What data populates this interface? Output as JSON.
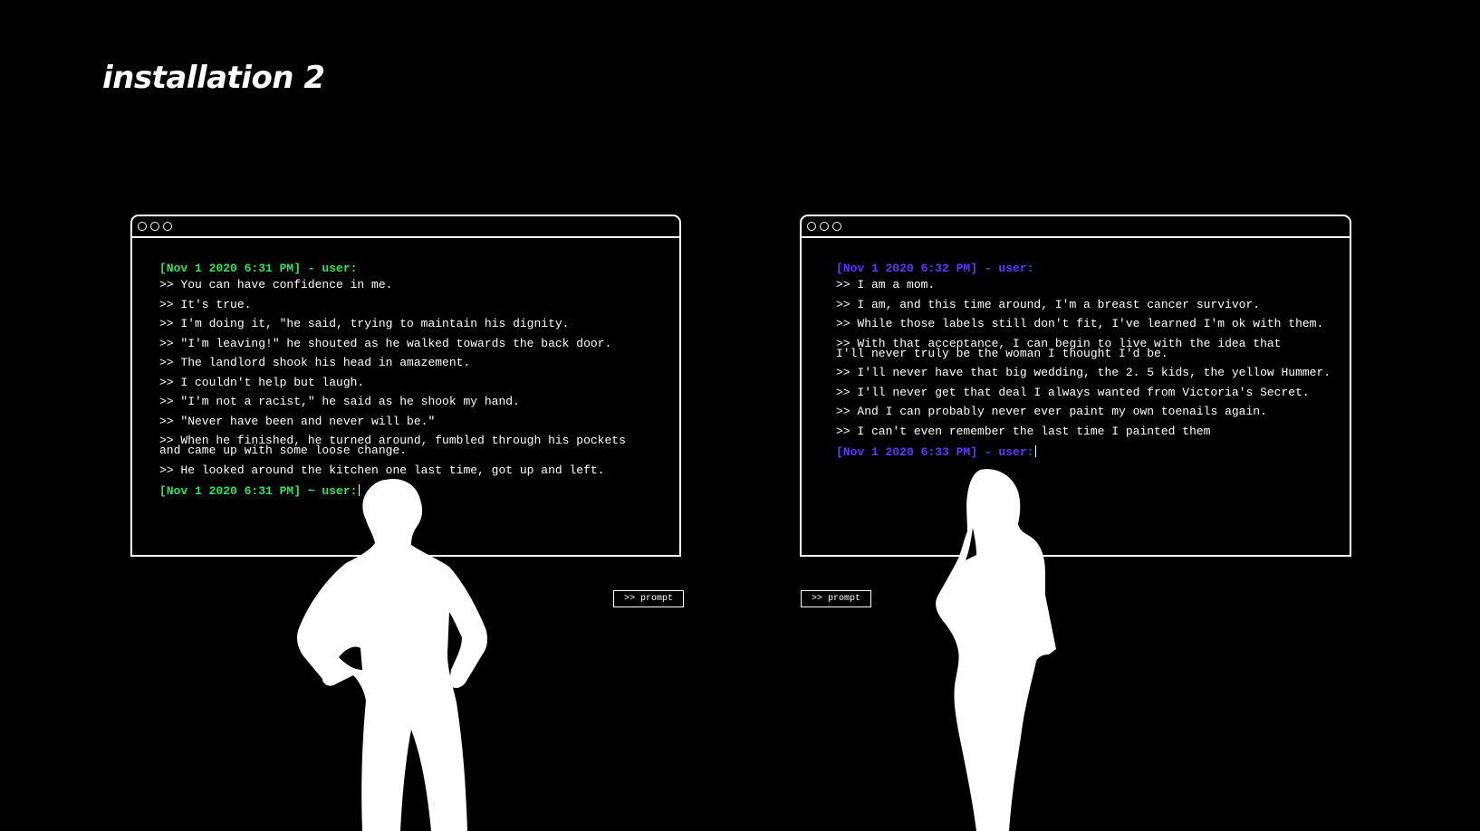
{
  "page": {
    "title": "installation 2"
  },
  "left_terminal": {
    "header": "[Nov 1 2020 6:31 PM] - user:",
    "lines": [
      ">> You can have confidence in me.",
      ">> It's true.",
      ">> I'm doing it, \"he said, trying to maintain his dignity.",
      ">> \"I'm leaving!\" he shouted as he walked towards the back door.",
      ">> The landlord shook his head in amazement.",
      ">> I couldn't help but laugh.",
      ">> \"I'm not a racist,\" he said as he shook my hand.",
      ">> \"Never have been and never will be.\"",
      ">> When he finished, he turned around, fumbled through his pockets\nand came up with some loose change.",
      ">> He looked around the kitchen one last time, got up and left."
    ],
    "footer": "[Nov 1 2020 6:31 PM] ~ user:",
    "accent": "#35e25a",
    "prompt_label": ">> prompt"
  },
  "right_terminal": {
    "header": "[Nov 1 2020 6:32 PM] - user:",
    "lines": [
      ">> I am a mom.",
      ">> I am, and this time around, I'm a breast cancer survivor.",
      ">> While those labels still don't fit, I've learned I'm ok with them.",
      ">> With that acceptance, I can begin to live with the idea that\nI'll never truly be the woman I thought I'd be.",
      ">> I'll never have that big wedding, the 2. 5 kids, the yellow Hummer.",
      ">> I'll never get that deal I always wanted from Victoria's Secret.",
      ">> And I can probably never ever paint my own toenails again.",
      ">> I can't even remember the last time I painted them"
    ],
    "footer": "[Nov 1 2020 6:33 PM] - user:",
    "accent": "#6236ff",
    "prompt_label": ">> prompt"
  }
}
